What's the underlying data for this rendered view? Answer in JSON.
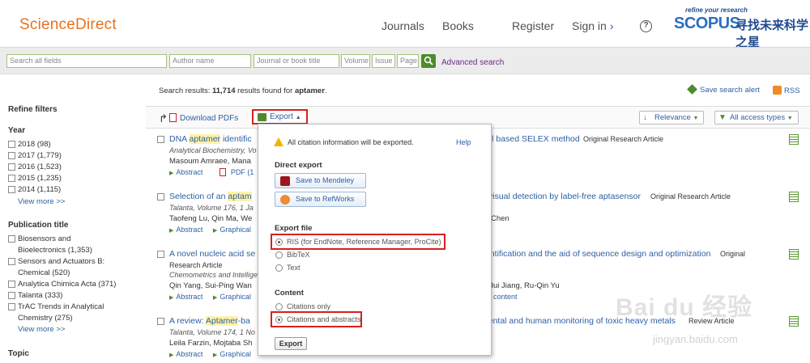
{
  "header": {
    "logo": "ScienceDirect",
    "nav": [
      "Journals",
      "Books",
      "Register",
      "Sign in"
    ],
    "help_glyph": "?",
    "scopus_tag": "refine your research",
    "scopus_word": "SCOPUS",
    "scopus_cn": "寻找未来科学之星"
  },
  "search": {
    "all_fields": "Search all fields",
    "author": "Author name",
    "journal": "Journal or book title",
    "volume": "Volume",
    "issue": "Issue",
    "page": "Page",
    "advanced": "Advanced search"
  },
  "sidebar": {
    "refine": "Refine filters",
    "year_heading": "Year",
    "years": [
      "2018 (98)",
      "2017 (1,779)",
      "2016 (1,523)",
      "2015 (1,235)",
      "2014 (1,115)"
    ],
    "view_more": "View more >>",
    "pub_heading": "Publication title",
    "pubs": [
      "Biosensors and",
      "Bioelectronics (1,353)",
      "Sensors and Actuators B:",
      "Chemical (520)",
      "Analytica Chimica Acta (371)",
      "Talanta (333)",
      "TrAC Trends in Analytical",
      "Chemistry (275)"
    ],
    "topic_heading": "Topic"
  },
  "results": {
    "prefix": "Search results: ",
    "count": "11,714",
    "middle": " results found for ",
    "term": "aptamer",
    "end": ".",
    "save_alert": "Save search alert",
    "rss": "RSS"
  },
  "toolbar": {
    "download": "Download PDFs",
    "export": "Export",
    "relevance": "Relevance",
    "access": "All access types"
  },
  "items": [
    {
      "t_pre": "DNA ",
      "t_hl": "aptamer",
      "t_post": " identific",
      "t_right": "all based SELEX method",
      "type": "Original Research Article",
      "journal": "Analytical Biochemistry, Vo",
      "authors": "Masoum Amraee, Mana",
      "links": "Abstract",
      "pdf": "PDF (1"
    },
    {
      "t_pre": "Selection of an ",
      "t_hl": "aptam",
      "t_post": "",
      "t_right": "visual detection by label-free aptasensor",
      "type": "Original Research Article",
      "journal": "Talanta, Volume 176, 1 Ja",
      "authors": "Taofeng Lu, Qin Ma, We",
      "authors_right": "Chen",
      "links": "Abstract",
      "link2": "Graphical"
    },
    {
      "t_pre": "A novel nucleic acid se",
      "t_hl": "",
      "t_post": "",
      "t_right": "entification and the aid of sequence design and optimization",
      "type": "Original",
      "type2": "Research Article",
      "journal": "Chemometrics and Intellige",
      "authors": "Qin Yang, Sui-Ping Wan",
      "authors_right": "-Hui Jiang, Ru-Qin Yu",
      "links": "Abstract",
      "link2": "Graphical",
      "extra": "ary content"
    },
    {
      "t_pre": "A review: ",
      "t_hl": "Aptamer",
      "t_post": "-ba",
      "t_right": "mental and human monitoring of toxic heavy metals",
      "type": "Review Article",
      "journal": "Talanta, Volume 174, 1 No",
      "authors": "Leila Farzin, Mojtaba Sh",
      "links": "Abstract",
      "link2": "Graphical"
    }
  ],
  "popup": {
    "warning": "All citation information will be exported.",
    "help": "Help",
    "direct_export": "Direct export",
    "mendeley": "Save to Mendeley",
    "refworks": "Save to RefWorks",
    "export_file": "Export file",
    "ris": "RIS (for EndNote, Reference Manager, ProCite)",
    "bibtex": "BibTeX",
    "text": "Text",
    "content": "Content",
    "citations_only": "Citations only",
    "citations_abstracts": "Citations and abstracts",
    "export_button": "Export"
  },
  "watermark": {
    "main": "Bai du 经验",
    "sub": "jingyan.baidu.com"
  }
}
